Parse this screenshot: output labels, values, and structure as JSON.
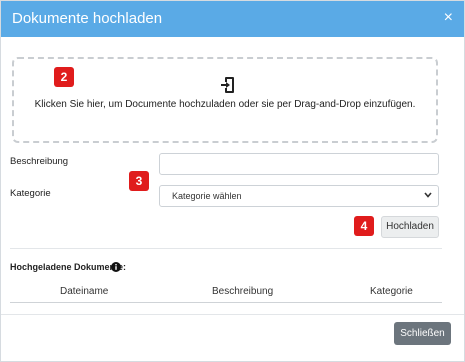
{
  "modal": {
    "title": "Dokumente hochladen",
    "close_symbol": "×"
  },
  "dropzone": {
    "icon": "file-upload-icon",
    "text": "Klicken Sie hier, um Documente hochzuladen oder sie per Drag-and-Drop einzufügen."
  },
  "markers": [
    "2",
    "3",
    "4"
  ],
  "form": {
    "description_label": "Beschreibung",
    "description_value": "",
    "category_label": "Kategorie",
    "category_selected": "Kategorie wählen"
  },
  "buttons": {
    "upload": "Hochladen",
    "close": "Schließen"
  },
  "documents": {
    "title": "Hochgeladene Dokumente:",
    "columns": [
      "Dateiname",
      "Beschreibung",
      "Kategorie"
    ],
    "rows": []
  },
  "colors": {
    "header": "#5aaae6",
    "marker": "#e01c1c",
    "close_button": "#6c757d"
  }
}
